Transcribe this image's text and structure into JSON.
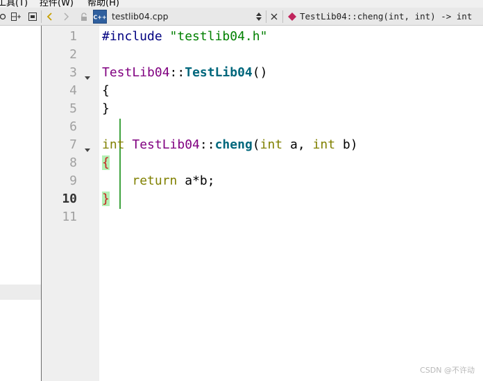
{
  "menu": {
    "items": [
      "工具(T)",
      "控件(W)",
      "帮助(H)"
    ]
  },
  "editor_bar": {
    "file_name": "testlib04.cpp",
    "file_badge": "C++",
    "symbol": "TestLib04::cheng(int, int) -> int"
  },
  "gutter": {
    "line_numbers": [
      "1",
      "2",
      "3",
      "4",
      "5",
      "6",
      "7",
      "8",
      "9",
      "10",
      "11"
    ],
    "current_line": "10"
  },
  "code": {
    "line1": {
      "directive": "#include",
      "path": "\"testlib04.h\""
    },
    "line3": {
      "class": "TestLib04",
      "scope": "::",
      "func": "TestLib04",
      "parens": "()"
    },
    "line4": {
      "text": "{"
    },
    "line5": {
      "text": "}"
    },
    "line7": {
      "ret_type": "int",
      "class": "TestLib04",
      "scope": "::",
      "func": "cheng",
      "open": "(",
      "type_a": "int",
      "param_a": "a",
      "comma": ", ",
      "type_b": "int",
      "param_b": "b",
      "close": ")"
    },
    "line8": {
      "brace": "{"
    },
    "line9": {
      "keyword": "return",
      "expr": "a*b;"
    },
    "line10": {
      "brace": "}"
    }
  },
  "watermark": "CSDN @不许动",
  "colors": {
    "function": "#00677c",
    "class": "#800080",
    "keyword": "#808000",
    "string": "#008000",
    "preprocessor": "#000080",
    "change_bar": "#3ea33e",
    "brace_match": "#b4f0b4"
  }
}
